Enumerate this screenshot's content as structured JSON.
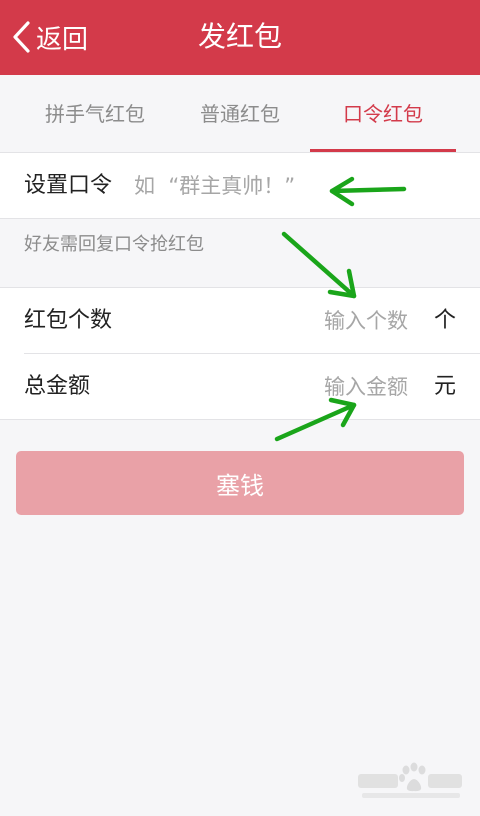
{
  "header": {
    "back_label": "返回",
    "title": "发红包",
    "background_color": "#d33a4a"
  },
  "tabs": [
    {
      "label": "拼手气红包",
      "active": false
    },
    {
      "label": "普通红包",
      "active": false
    },
    {
      "label": "口令红包",
      "active": true
    }
  ],
  "password": {
    "label": "设置口令",
    "placeholder": "如  “群主真帅！”",
    "value": ""
  },
  "hint": "好友需回复口令抢红包",
  "count": {
    "label": "红包个数",
    "placeholder": "输入个数",
    "unit": "个"
  },
  "amount": {
    "label": "总金额",
    "placeholder": "输入金额",
    "unit": "元"
  },
  "submit": {
    "label": "塞钱",
    "color": "#e9a1a7"
  },
  "annotations": {
    "arrow_color": "#1aa51a"
  },
  "icons": [
    "chevron-left-icon",
    "baidu-paw-icon"
  ]
}
